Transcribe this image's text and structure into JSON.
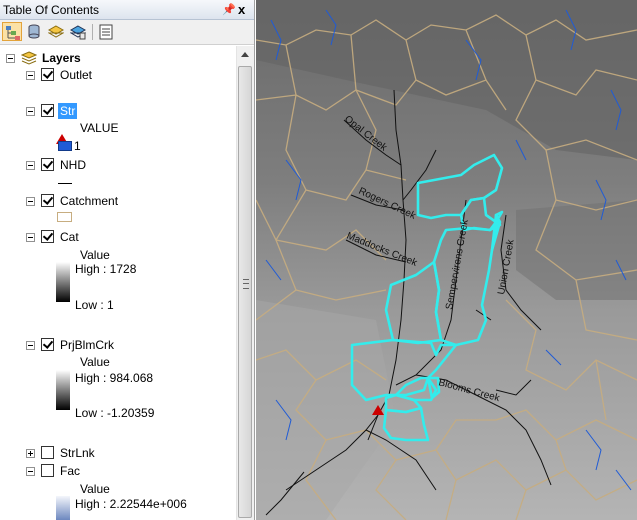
{
  "toc": {
    "title": "Table Of Contents",
    "pin_glyph": "ᵖ",
    "close_glyph": "x"
  },
  "tree": {
    "root_label": "Layers",
    "layers": [
      {
        "name": "Outlet",
        "checked": true,
        "expanded": true
      },
      {
        "name": "Str",
        "checked": true,
        "expanded": true,
        "selected": true,
        "field": "VALUE",
        "class_label": "1",
        "swatch": "#1f5bd6"
      },
      {
        "name": "NHD",
        "checked": true,
        "expanded": true
      },
      {
        "name": "Catchment",
        "checked": true,
        "expanded": true
      },
      {
        "name": "Cat",
        "checked": true,
        "expanded": true,
        "field": "Value",
        "high": "High : 1728",
        "low": "Low : 1"
      },
      {
        "name": "PrjBlmCrk",
        "checked": true,
        "expanded": true,
        "field": "Value",
        "high": "High : 984.068",
        "low": "Low : -1.20359"
      },
      {
        "name": "StrLnk",
        "checked": false,
        "expanded": false
      },
      {
        "name": "Fac",
        "checked": false,
        "expanded": true,
        "field": "Value",
        "high": "High : 2.22544e+006"
      }
    ]
  },
  "map": {
    "labels": [
      "Opal Creek",
      "Rogers Creek",
      "Maddocks Creek",
      "Sempervirens Creek",
      "Union Creek",
      "Blooms Creek"
    ],
    "colors": {
      "catchment": "#c7ad80",
      "selected": "#33ecec",
      "stream": "#1f5bd6",
      "outlet": "#cc0000"
    }
  }
}
